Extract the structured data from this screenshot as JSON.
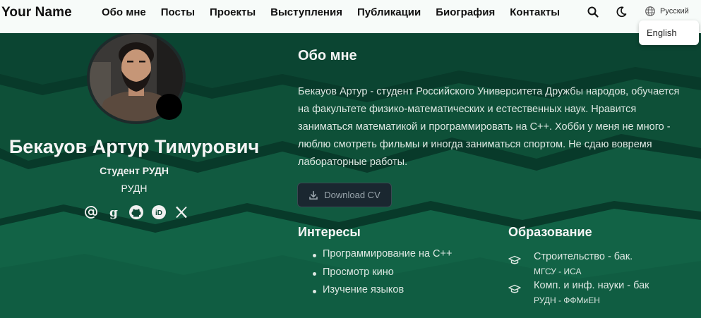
{
  "navbar": {
    "brand": "Your Name",
    "links": [
      "Обо мне",
      "Посты",
      "Проекты",
      "Выступления",
      "Публикации",
      "Биография",
      "Контакты"
    ],
    "search_icon": "search-icon",
    "theme_icon": "moon-icon",
    "language_icon": "globe-icon",
    "language_current": "Русский",
    "language_options": [
      "English"
    ]
  },
  "profile": {
    "name": "Бекауов Артур Тимурович",
    "role": "Студент РУДН",
    "organization": "РУДН",
    "socials": [
      "at-icon",
      "google-scholar-icon",
      "github-icon",
      "orcid-icon",
      "x-icon"
    ]
  },
  "about": {
    "title": "Обо мне",
    "lines": [
      "Бекауов Артур - студент Российского Университета Дружбы народов, обучается",
      "на факультете физико-математических и естественных наук. Нравится",
      "заниматься математикой и программировать на C++. Хобби у меня не много -",
      "люблю смотреть фильмы и иногда заниматься спортом. Не сдаю вовремя",
      "лабораторные работы."
    ],
    "cv_button": "Download CV"
  },
  "interests": {
    "title": "Интересы",
    "items": [
      "Программирование на C++",
      "Просмотр кино",
      "Изучение языков"
    ]
  },
  "education": {
    "title": "Образование",
    "items": [
      {
        "degree": "Строительство - бак.",
        "institution": "МГСУ - ИСА"
      },
      {
        "degree": "Комп. и инф. науки - бак",
        "institution": "РУДН - ФФМиЕН"
      }
    ]
  },
  "colors": {
    "background": "#0a3d2c",
    "navbar": "#f7fbf9",
    "text_light": "#dde7e2"
  }
}
